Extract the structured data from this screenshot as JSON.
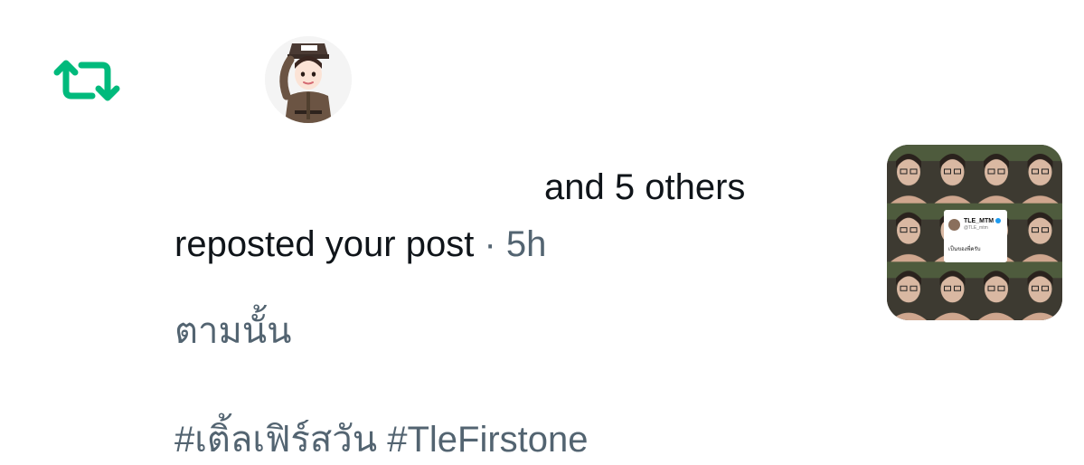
{
  "notification": {
    "others_text": "and 5 others",
    "action_text": "reposted your post",
    "separator": "·",
    "time": "5h"
  },
  "post": {
    "text": "ตามนั้น",
    "hashtags": "#เติ้ลเฟิร์สวัน #TleFirstone"
  },
  "media": {
    "card_name": "TLE_MTM",
    "card_handle": "@TLE_mtm",
    "card_text": "เป็นของพี่ครับ"
  },
  "icons": {
    "repost": "repost-icon",
    "verified": "verified-badge-icon"
  },
  "colors": {
    "repost_green": "#00ba7c",
    "primary_text": "#0f1419",
    "secondary_text": "#536471",
    "verified_blue": "#1d9bf0"
  }
}
